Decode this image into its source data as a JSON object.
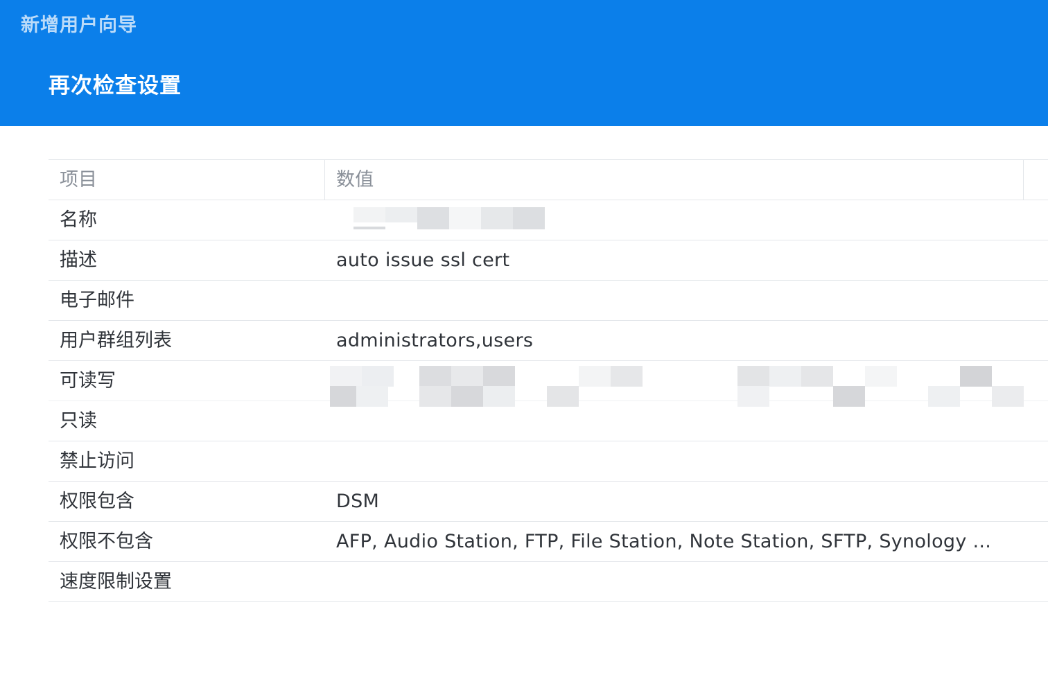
{
  "header": {
    "wizard_title": "新增用户向导",
    "step_title": "再次检查设置"
  },
  "table": {
    "col_key": "项目",
    "col_value": "数值",
    "rows": [
      {
        "key": "名称",
        "value": ""
      },
      {
        "key": "描述",
        "value": "auto issue ssl cert"
      },
      {
        "key": "电子邮件",
        "value": ""
      },
      {
        "key": "用户群组列表",
        "value": "administrators,users"
      },
      {
        "key": "可读写",
        "value": ""
      },
      {
        "key": "只读",
        "value": ""
      },
      {
        "key": "禁止访问",
        "value": ""
      },
      {
        "key": "权限包含",
        "value": "DSM"
      },
      {
        "key": "权限不包含",
        "value": "AFP, Audio Station, FTP, File Station, Note Station, SFTP, Synology ..."
      },
      {
        "key": "速度限制设置",
        "value": ""
      }
    ]
  },
  "colors": {
    "header_bg": "#0b7fea",
    "redaction": "#d7d9dc"
  }
}
